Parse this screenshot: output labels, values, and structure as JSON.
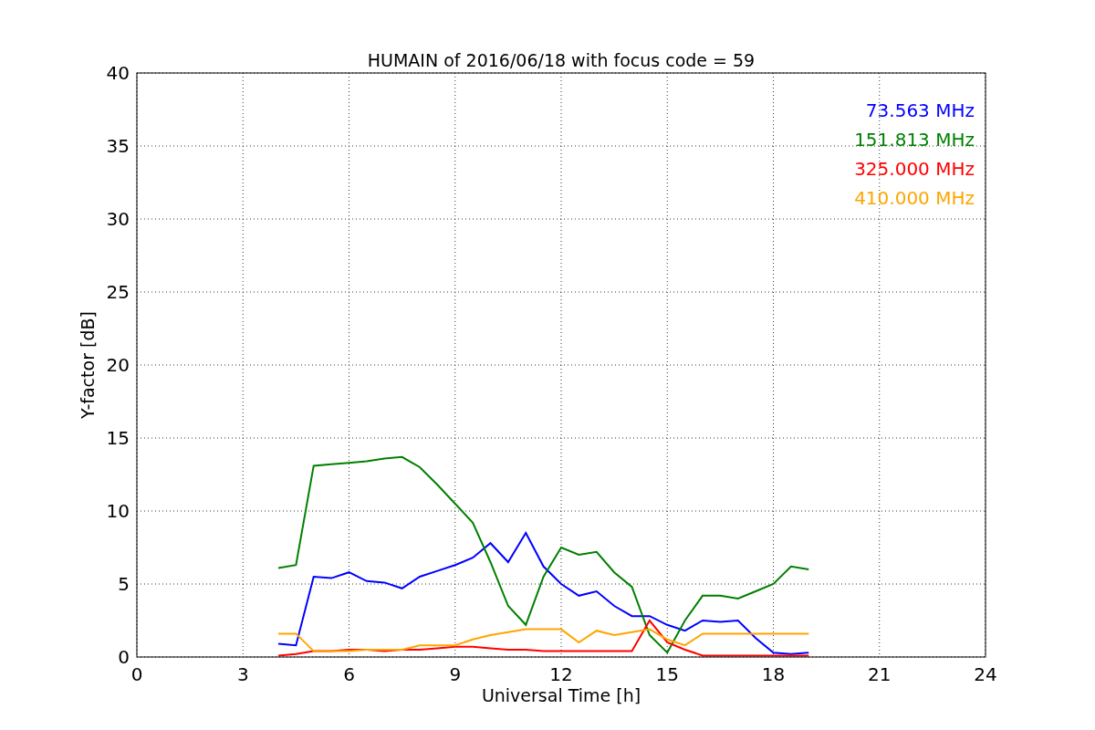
{
  "figure": {
    "chart_data": {
      "type": "line",
      "grid": true,
      "title": "HUMAIN of 2016/06/18 with focus code = 59",
      "xlabel": "Universal Time [h]",
      "ylabel": "Y-factor [dB]",
      "xlim": [
        0,
        24
      ],
      "ylim": [
        0,
        40
      ],
      "xticks": [
        0,
        3,
        6,
        9,
        12,
        15,
        18,
        21,
        24
      ],
      "yticks": [
        0,
        5,
        10,
        15,
        20,
        25,
        30,
        35,
        40
      ],
      "x": [
        4,
        4.5,
        5,
        5.5,
        6,
        6.5,
        7,
        7.5,
        8,
        8.5,
        9,
        9.5,
        10,
        10.5,
        11,
        11.5,
        12,
        12.5,
        13,
        13.5,
        14,
        14.5,
        15,
        15.5,
        16,
        16.5,
        17,
        17.5,
        18,
        18.5,
        19
      ],
      "series": [
        {
          "name": "73.563 MHz",
          "color": "#0000ff",
          "values": [
            0.9,
            0.8,
            5.5,
            5.4,
            5.8,
            5.2,
            5.1,
            4.7,
            5.5,
            5.9,
            6.3,
            6.8,
            7.8,
            6.5,
            8.5,
            6.2,
            5.0,
            4.2,
            4.5,
            3.5,
            2.8,
            2.8,
            2.2,
            1.8,
            2.5,
            2.4,
            2.5,
            1.3,
            0.3,
            0.2,
            0.3
          ]
        },
        {
          "name": "151.813 MHz",
          "color": "#008000",
          "values": [
            6.1,
            6.3,
            13.1,
            13.2,
            13.3,
            13.4,
            13.6,
            13.7,
            13.0,
            11.8,
            10.5,
            9.2,
            6.5,
            3.5,
            2.2,
            5.5,
            7.5,
            7.0,
            7.2,
            5.8,
            4.8,
            1.5,
            0.3,
            2.5,
            4.2,
            4.2,
            4.0,
            4.5,
            5.0,
            6.2,
            6.0
          ]
        },
        {
          "name": "325.000 MHz",
          "color": "#ff0000",
          "values": [
            0.1,
            0.2,
            0.4,
            0.4,
            0.5,
            0.5,
            0.4,
            0.5,
            0.5,
            0.6,
            0.7,
            0.7,
            0.6,
            0.5,
            0.5,
            0.4,
            0.4,
            0.4,
            0.4,
            0.4,
            0.4,
            2.5,
            1.0,
            0.5,
            0.1,
            0.1,
            0.1,
            0.1,
            0.1,
            0.1,
            0.1
          ]
        },
        {
          "name": "410.000 MHz",
          "color": "#ffa500",
          "values": [
            1.6,
            1.6,
            0.4,
            0.4,
            0.4,
            0.5,
            0.5,
            0.5,
            0.8,
            0.8,
            0.8,
            1.2,
            1.5,
            1.7,
            1.9,
            1.9,
            1.9,
            1.0,
            1.8,
            1.5,
            1.7,
            1.9,
            1.2,
            0.8,
            1.6,
            1.6,
            1.6,
            1.6,
            1.6,
            1.6,
            1.6
          ]
        }
      ]
    }
  }
}
